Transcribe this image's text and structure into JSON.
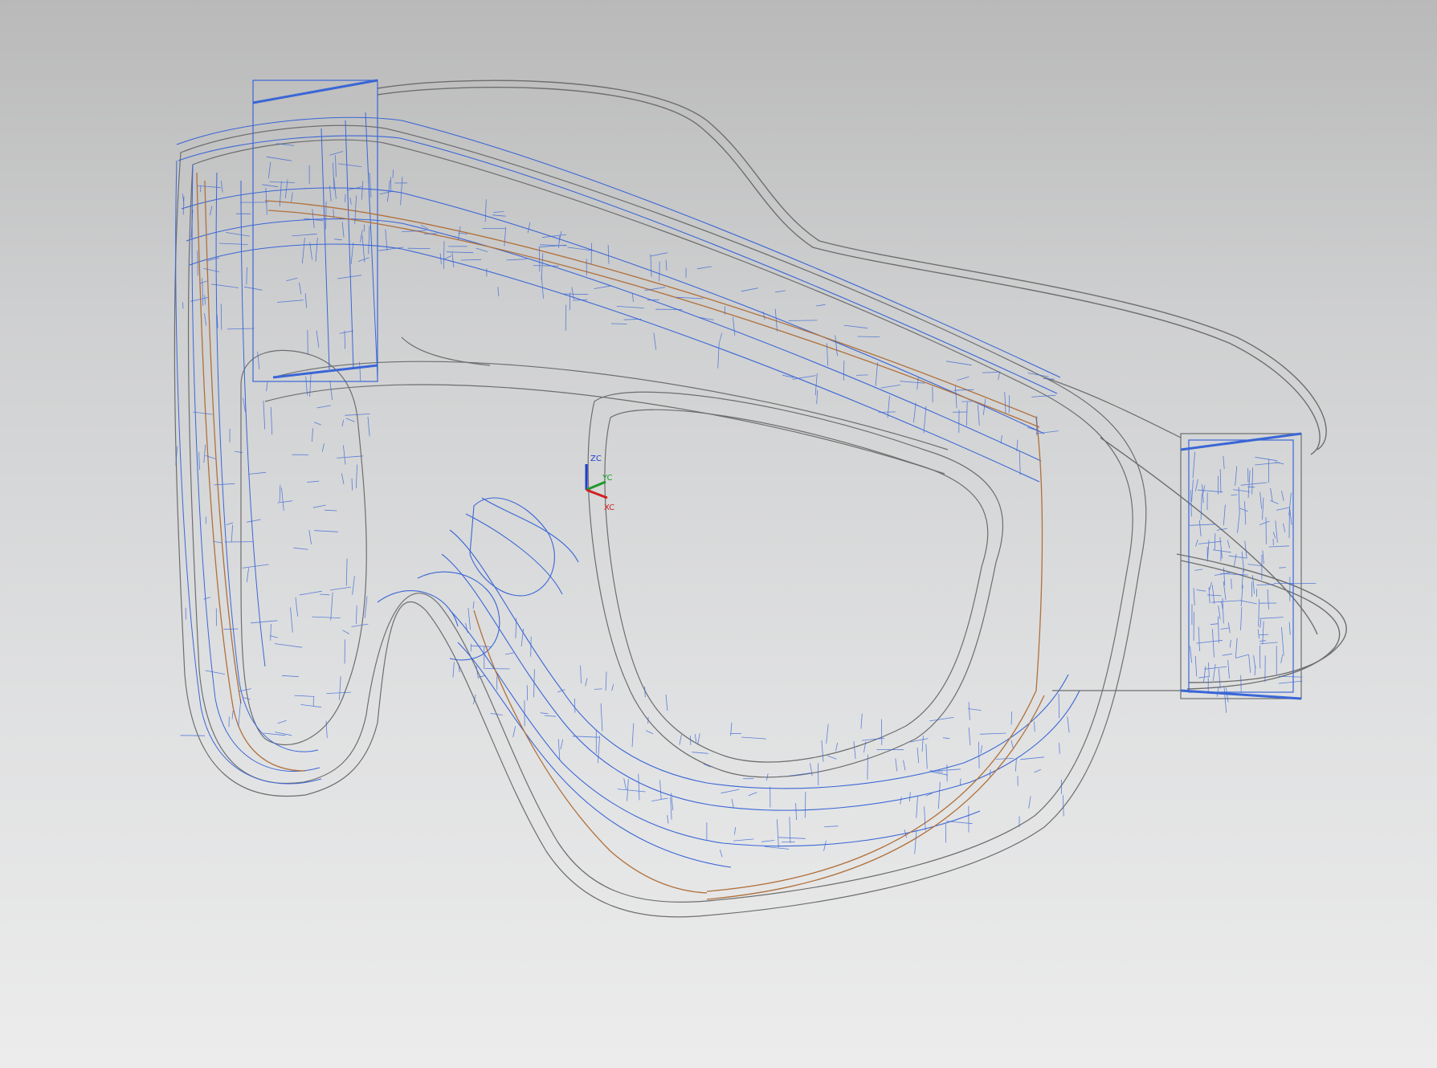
{
  "viewport": {
    "model_name": "",
    "render_mode": "wireframe",
    "colors": {
      "background_top": "#b9b9b9",
      "background_bottom": "#ececec",
      "edge_blue": "#3a66d6",
      "edge_gray": "#6e6e6e",
      "edge_orange": "#b0703a"
    }
  },
  "triad": {
    "z_label": "ZC",
    "y_label": "YC",
    "x_label": "XC",
    "z_color": "#1f3fd0",
    "y_color": "#1d9a2a",
    "x_color": "#d02020"
  }
}
